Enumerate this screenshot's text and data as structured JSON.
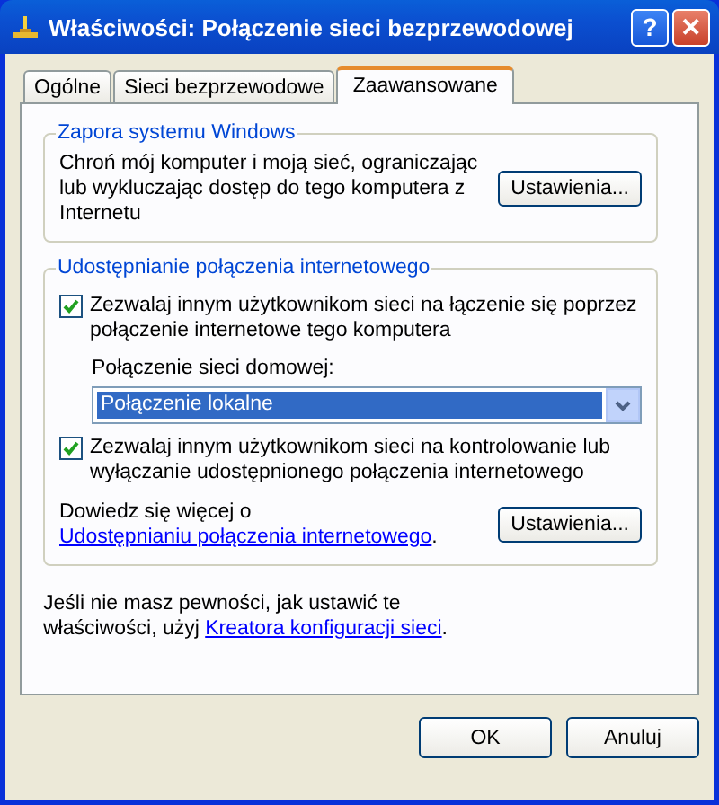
{
  "window": {
    "title": "Właściwości: Połączenie sieci bezprzewodowej",
    "buttons": [
      {
        "kind": "help",
        "label": "?"
      },
      {
        "kind": "close",
        "label": "✕"
      }
    ]
  },
  "tabs": [
    {
      "label": "Ogólne",
      "selected": false
    },
    {
      "label": "Sieci bezprzewodowe",
      "selected": false
    },
    {
      "label": "Zaawansowane",
      "selected": true
    }
  ],
  "firewall": {
    "title": "Zapora systemu Windows",
    "text": "Chroń mój komputer i moją sieć, ograniczając lub wykluczając dostęp do tego komputera z Internetu",
    "button": "Ustawienia..."
  },
  "sharing": {
    "title": "Udostępnianie połączenia internetowego",
    "checkboxes": [
      {
        "label": "Zezwalaj innym użytkownikom sieci na łączenie się poprzez połączenie internetowe tego komputera",
        "checked": true
      }
    ],
    "home_network": {
      "label": "Połączenie sieci domowej:",
      "value": "Połączenie lokalne"
    },
    "checkboxes_2": [
      {
        "label": "Zezwalaj innym użytkownikom sieci na kontrolowanie lub wyłączanie udostępnionego połączenia internetowego",
        "checked": true
      }
    ],
    "learn_more": {
      "before": "Dowiedz się więcej o ",
      "link": "Udostępnianiu połączenia internetowego",
      "after": "."
    },
    "button": "Ustawienia..."
  },
  "hint": {
    "before": "Jeśli nie masz pewności, jak ustawić te właściwości, użyj ",
    "link": "Kreatora konfiguracji sieci",
    "after": "."
  },
  "buttons": [
    "OK",
    "Anuluj"
  ]
}
